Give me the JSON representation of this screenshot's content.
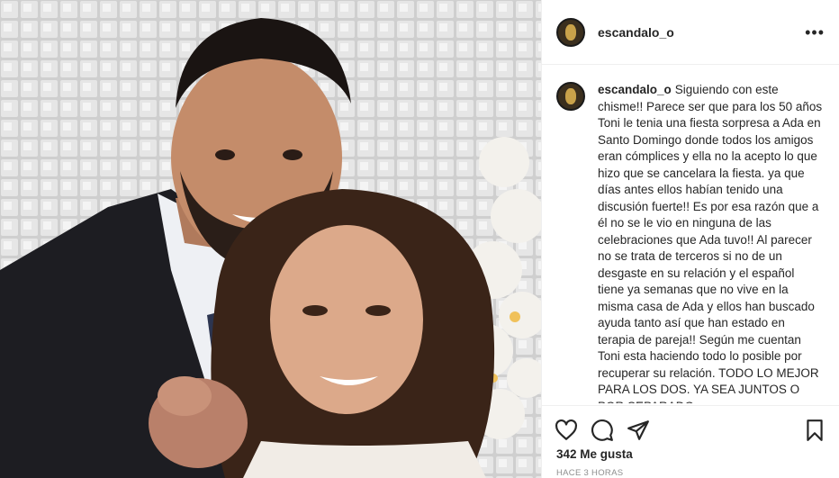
{
  "post": {
    "username": "escandalo_o",
    "more_label": "•••",
    "caption_username": "escandalo_o",
    "caption_text": "Siguiendo con este chisme!! Parece ser que para los 50 años Toni le tenia una fiesta sorpresa a Ada en Santo Domingo donde todos los amigos eran cómplices y ella no la acepto lo que hizo que se cancelara la fiesta. ya que días antes ellos habían tenido una discusión fuerte!! Es por esa razón que a él no se le vio en ninguna de las celebraciones que Ada tuvo!! Al parecer no se trata de terceros si no de un desgaste en su relación y el español tiene ya semanas que no vive en la misma casa de Ada y ellos han buscado ayuda tanto así que han estado en terapia de pareja!! Según me cuentan Toni esta haciendo todo lo posible por recuperar su relación. TODO LO MEJOR PARA LOS DOS. YA SEA JUNTOS O POR SEPARADO",
    "likes": "342 Me gusta",
    "timestamp": "HACE 3 HORAS"
  },
  "icons": {
    "like": "heart-icon",
    "comment": "comment-icon",
    "share": "share-icon",
    "save": "bookmark-icon"
  },
  "colors": {
    "text": "#262626",
    "muted": "#8e8e8e",
    "border": "#efefef"
  }
}
